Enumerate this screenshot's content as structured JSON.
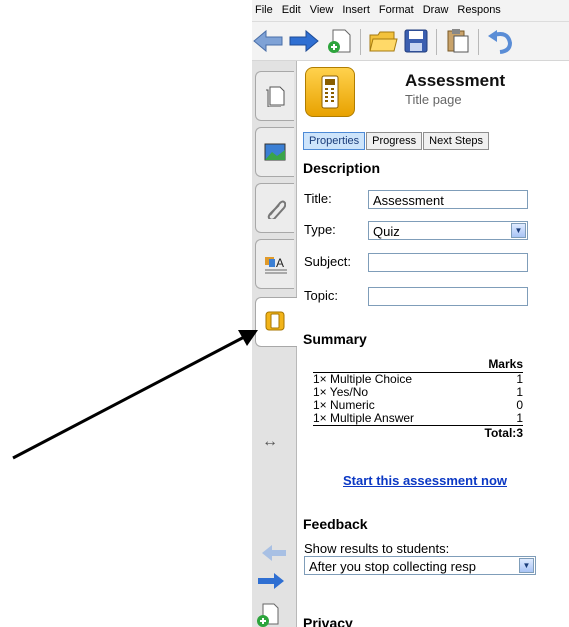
{
  "menubar": {
    "items": [
      "File",
      "Edit",
      "View",
      "Insert",
      "Format",
      "Draw",
      "Respons"
    ]
  },
  "toolbar": {
    "icons": [
      "back-arrow-icon",
      "forward-arrow-icon",
      "new-page-icon",
      "open-folder-icon",
      "save-icon",
      "paste-icon",
      "undo-icon"
    ]
  },
  "sidetabs": [
    "pages-tab",
    "gallery-tab",
    "attachments-tab",
    "properties-tab",
    "assessment-tab"
  ],
  "panel": {
    "title": "Assessment",
    "subtitle": "Title page",
    "tabs": [
      "Properties",
      "Progress",
      "Next Steps"
    ],
    "description": {
      "heading": "Description",
      "title_label": "Title:",
      "title_value": "Assessment",
      "type_label": "Type:",
      "type_value": "Quiz",
      "subject_label": "Subject:",
      "subject_value": "",
      "topic_label": "Topic:",
      "topic_value": ""
    },
    "summary": {
      "heading": "Summary",
      "marks_header": "Marks",
      "rows": [
        {
          "name": "1× Multiple Choice",
          "marks": "1"
        },
        {
          "name": "1× Yes/No",
          "marks": "1"
        },
        {
          "name": "1× Numeric",
          "marks": "0"
        },
        {
          "name": "1× Multiple Answer",
          "marks": "1"
        }
      ],
      "total_label": "Total:",
      "total_value": "3"
    },
    "start_link": "Start this assessment now",
    "feedback": {
      "heading": "Feedback",
      "show_label": "Show results to students:",
      "show_value": "After you stop collecting resp"
    },
    "privacy_heading": "Privacy"
  },
  "colors": {
    "accent": "#0b38c4",
    "tab_active": "#cde4fb",
    "tab_strip": "#e2e2e2"
  }
}
